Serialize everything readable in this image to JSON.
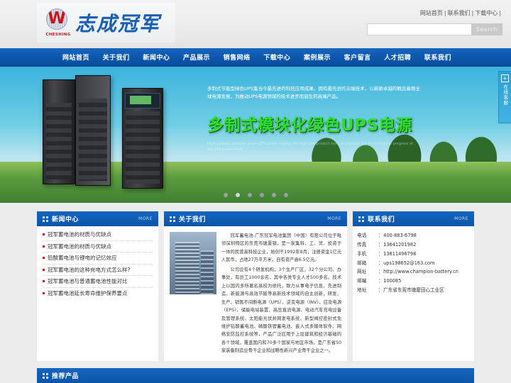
{
  "header": {
    "logo_text": "志成冠军",
    "logo_sub": "CHESHING",
    "top_links": [
      "网站首页",
      "联系我们",
      "下载中心"
    ],
    "search": {
      "value": "",
      "placeholder": "",
      "button_label": "Search"
    }
  },
  "nav": {
    "items": [
      "网站首页",
      "关于我们",
      "新闻中心",
      "产品展示",
      "销售网络",
      "下载中心",
      "案例展示",
      "客户留言",
      "人才招聘",
      "联系我们"
    ]
  },
  "banner": {
    "description": "多制式节能型绿色UPS集当今最先进的科技应用成果，拥有最先进的尖端技术，以新颖卓越的概念着眼全球电源发展，为推动UPS电源领域的技术进步而诞生的高端产品。",
    "title": "多制式模块化绿色UPS电源",
    "subtitle": "Multi-system modular green UPS power supply, the high-end product born to promote the technological progress of the UPS power field.",
    "dots_count": 6,
    "active_dot": 1
  },
  "side_tab": {
    "label": "在线客服",
    "icon": "plus-square-icon"
  },
  "news": {
    "title": "新闻中心",
    "more": "MORE",
    "items": [
      "冠军蓄电池的材质与优缺点",
      "冠军蓄电池的材质与优缺点",
      "铅酸蓄电池与锂电的记忆效应",
      "冠军蓄电池的这种充电方式怎么样?",
      "冠军蓄电池与普通蓄电池性能对比",
      "冠军蓄电池延长寿命维护保养要点"
    ]
  },
  "about": {
    "title": "关于我们",
    "more": "MORE",
    "paragraphs": [
      "冠军蓄电池-广东冠军电池集团（中国）有限公司位于毗邻深圳特区的东莞市塘厦镇，是一家集科、工、贸、投资于一体的民营高科技企业，始创于1992年8月，注册资金1亿元人民币，占地27万平方米，自有资产逾6.5亿元。",
      "公司设有4个研发机构，3个生产厂区，32个分公司、办事处，有员工1000余名，其中各类专业人才500多名。技术上以国内多所著名高校为依托，致力从事电子信息、先进制造、新能源与高效节能等高新技术领域的自主创新，研发、生产、销售不间断电源（UPS）、逆变电源（INV）、应急电源（EPS）、储能电站装置、高压直流电源、电动汽车充电设备及管理系统、太阳能光伏并网发电系统、新型阀控密封式免维护铅酸蓄电池、磷酸铁锂蓄电池、嵌入式多媒体软件、网络安防监控系统等，产品广泛应用于上层建筑和经济基础的各个领域，覆盖国内和70多个国家与地区市场，是广东省50家装备制造业骨干企业和战略性新兴产业骨干企业之一。"
    ]
  },
  "contact": {
    "title": "联系我们",
    "more": "MORE",
    "rows": [
      {
        "label": "电话",
        "value": "400-883-6798"
      },
      {
        "label": "传真",
        "value": "13641201982"
      },
      {
        "label": "手机",
        "value": "13811496798"
      },
      {
        "label": "邮箱",
        "value": "ups198652@163.com"
      },
      {
        "label": "网址",
        "value": "http://www.champion-battery.cn"
      },
      {
        "label": "邮编",
        "value": "100085"
      },
      {
        "label": "地址",
        "value": "广东省东莞市塘厦田心工业区"
      }
    ]
  },
  "bottom": {
    "title": "推荐产品"
  }
}
